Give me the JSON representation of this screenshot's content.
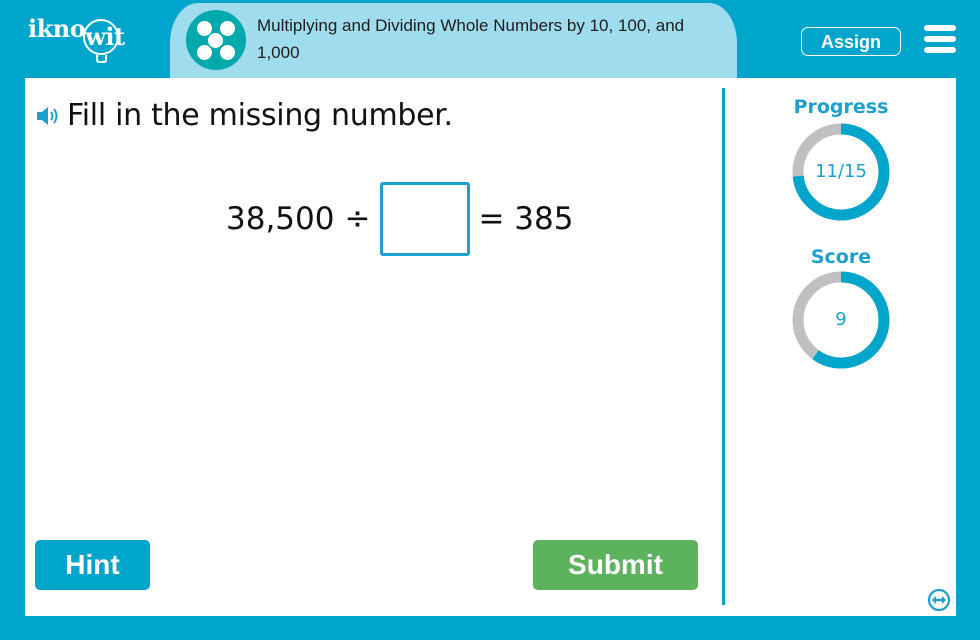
{
  "header": {
    "logo_text_pre": "ikno",
    "logo_text_post": "it",
    "logo_bulb_letter": "w",
    "topic_icon": "five-dots-icon",
    "title": "Multiplying and Dividing Whole Numbers by 10, 100, and 1,000",
    "assign_label": "Assign",
    "menu_icon": "hamburger-menu-icon"
  },
  "question": {
    "speaker_icon": "speaker-icon",
    "prompt": "Fill in the missing number.",
    "left_operand": "38,500",
    "operator": "÷",
    "answer_value": "",
    "equals_text": "= 385"
  },
  "sidebar": {
    "progress": {
      "label": "Progress",
      "text": "11/15",
      "fraction": 0.733
    },
    "score": {
      "label": "Score",
      "text": "9",
      "fraction": 0.6
    }
  },
  "buttons": {
    "hint_label": "Hint",
    "submit_label": "Submit"
  },
  "colors": {
    "brand_blue": "#00a5cc",
    "pill_blue": "#9fdcee",
    "topic_teal": "#00a9ab",
    "submit_green": "#5cb25d",
    "ring_track": "#c0c0c0"
  }
}
